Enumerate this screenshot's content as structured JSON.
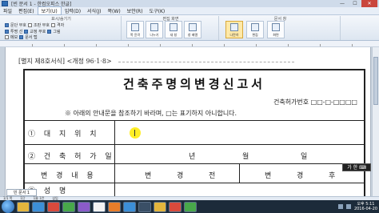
{
  "window": {
    "title": "[빈 문서 1 - 한컴오피스 한글]",
    "controls": [
      "—",
      "☐",
      "✕"
    ]
  },
  "menu": {
    "items": [
      "파일",
      "편집(E)",
      "보기(U)",
      "입력(D)",
      "서식(J)",
      "쪽(W)",
      "보안(R)",
      "도구(K)"
    ],
    "active_index": 2
  },
  "ribbon": {
    "groups": [
      "표시/숨기기",
      "편집 화면",
      "문서 창"
    ],
    "checks": [
      {
        "label": "문단 부호",
        "on": true
      },
      {
        "label": "조판 부호",
        "on": false
      },
      {
        "label": "격자",
        "on": false
      },
      {
        "label": "투명 선",
        "on": true
      },
      {
        "label": "교정 부호",
        "on": true
      },
      {
        "label": "그림",
        "on": true
      },
      {
        "label": "메모",
        "on": false
      },
      {
        "label": "문서 탭",
        "on": true
      }
    ],
    "buttons": [
      "쪽 윤곽",
      "나누기",
      "새 창",
      "창 배열",
      "나란히",
      "편집",
      "화면"
    ]
  },
  "document": {
    "form_meta": "[별지 제8호서식] <개정 96·1·8>",
    "title": "건축주명의변경신고서",
    "permit_no_label": "건축허가번호 □□-□-□□□□",
    "note": "※ 아래의 안내문을 참조하기 바라며, □는 표기하지 아니합니다.",
    "rows": [
      {
        "label": "① 대 지 위 치"
      },
      {
        "label": "② 건 축 허 가 일",
        "values": [
          "년",
          "월",
          "일"
        ]
      },
      {
        "label": "변 경 내 용",
        "values": [
          "변",
          "경",
          "전",
          "변",
          "경",
          "후"
        ]
      },
      {
        "label": "③ 성 명"
      }
    ]
  },
  "ime": "가 한 ⌨",
  "sheet_tab": "빈 문서 1",
  "status": [
    "1/1 쪽",
    "1단",
    "1줄 1칸",
    "삽입"
  ],
  "clock": {
    "time": "오후 5:11",
    "date": "2016-04-20"
  }
}
